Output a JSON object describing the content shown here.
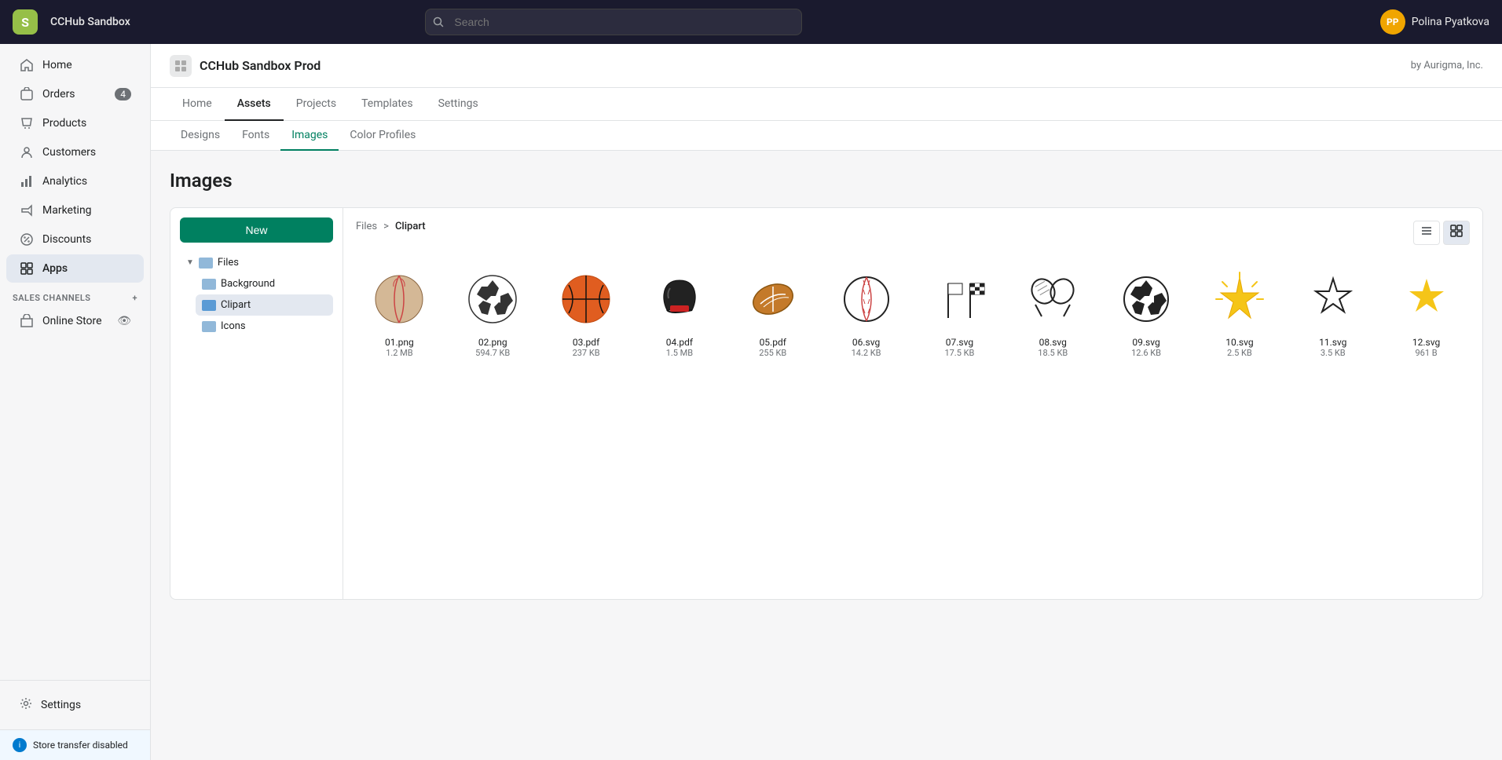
{
  "topbar": {
    "logo_text": "S",
    "store_name": "CCHub Sandbox",
    "search_placeholder": "Search",
    "user_initials": "PP",
    "user_name": "Polina Pyatkova"
  },
  "sidebar": {
    "items": [
      {
        "id": "home",
        "label": "Home",
        "icon": "home-icon",
        "badge": null
      },
      {
        "id": "orders",
        "label": "Orders",
        "icon": "orders-icon",
        "badge": "4"
      },
      {
        "id": "products",
        "label": "Products",
        "icon": "products-icon",
        "badge": null
      },
      {
        "id": "customers",
        "label": "Customers",
        "icon": "customers-icon",
        "badge": null
      },
      {
        "id": "analytics",
        "label": "Analytics",
        "icon": "analytics-icon",
        "badge": null
      },
      {
        "id": "marketing",
        "label": "Marketing",
        "icon": "marketing-icon",
        "badge": null
      },
      {
        "id": "discounts",
        "label": "Discounts",
        "icon": "discounts-icon",
        "badge": null
      },
      {
        "id": "apps",
        "label": "Apps",
        "icon": "apps-icon",
        "badge": null,
        "active": true
      }
    ],
    "sales_channels_label": "SALES CHANNELS",
    "sales_channels": [
      {
        "id": "online-store",
        "label": "Online Store"
      }
    ],
    "settings_label": "Settings",
    "store_transfer_label": "Store transfer disabled"
  },
  "app": {
    "title": "CCHub Sandbox Prod",
    "by_label": "by Aurigma, Inc.",
    "tabs": [
      {
        "id": "home",
        "label": "Home"
      },
      {
        "id": "assets",
        "label": "Assets",
        "active": true
      },
      {
        "id": "projects",
        "label": "Projects"
      },
      {
        "id": "templates",
        "label": "Templates"
      },
      {
        "id": "settings",
        "label": "Settings"
      }
    ],
    "sub_tabs": [
      {
        "id": "designs",
        "label": "Designs"
      },
      {
        "id": "fonts",
        "label": "Fonts"
      },
      {
        "id": "images",
        "label": "Images",
        "active": true
      },
      {
        "id": "color-profiles",
        "label": "Color Profiles"
      }
    ]
  },
  "images_page": {
    "title": "Images",
    "new_button": "New",
    "breadcrumb": {
      "files": "Files",
      "sep": ">",
      "clipart": "Clipart"
    },
    "tree": {
      "files_label": "Files",
      "background_label": "Background",
      "clipart_label": "Clipart",
      "icons_label": "Icons"
    },
    "files": [
      {
        "name": "01.png",
        "size": "1.2 MB",
        "type": "baseball"
      },
      {
        "name": "02.png",
        "size": "594.7 KB",
        "type": "soccer"
      },
      {
        "name": "03.pdf",
        "size": "237 KB",
        "type": "basketball"
      },
      {
        "name": "04.pdf",
        "size": "1.5 MB",
        "type": "helmet"
      },
      {
        "name": "05.pdf",
        "size": "255 KB",
        "type": "football"
      },
      {
        "name": "06.svg",
        "size": "14.2 KB",
        "type": "baseball2"
      },
      {
        "name": "07.svg",
        "size": "17.5 KB",
        "type": "flags"
      },
      {
        "name": "08.svg",
        "size": "18.5 KB",
        "type": "rackets"
      },
      {
        "name": "09.svg",
        "size": "12.6 KB",
        "type": "soccer2"
      },
      {
        "name": "10.svg",
        "size": "2.5 KB",
        "type": "star-yellow"
      },
      {
        "name": "11.svg",
        "size": "3.5 KB",
        "type": "star-outline"
      },
      {
        "name": "12.svg",
        "size": "961 B",
        "type": "star-solid"
      }
    ]
  }
}
